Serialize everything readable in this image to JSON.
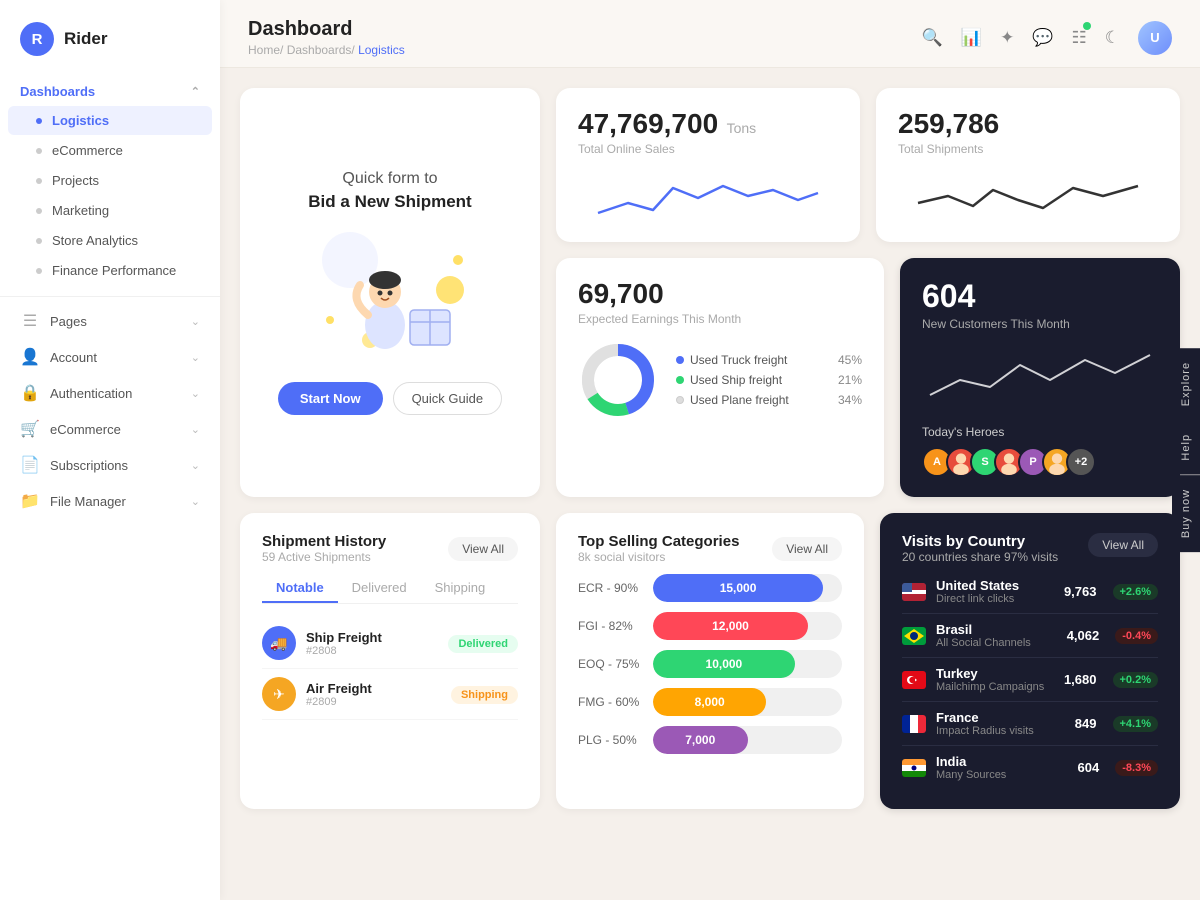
{
  "app": {
    "logo_letter": "R",
    "logo_name": "Rider"
  },
  "sidebar": {
    "dashboards_label": "Dashboards",
    "items": [
      {
        "label": "Logistics",
        "active": true
      },
      {
        "label": "eCommerce",
        "active": false
      },
      {
        "label": "Projects",
        "active": false
      },
      {
        "label": "Marketing",
        "active": false
      },
      {
        "label": "Store Analytics",
        "active": false
      },
      {
        "label": "Finance Performance",
        "active": false
      }
    ],
    "pages_label": "Pages",
    "account_label": "Account",
    "authentication_label": "Authentication",
    "ecommerce_label": "eCommerce",
    "subscriptions_label": "Subscriptions",
    "file_manager_label": "File Manager"
  },
  "header": {
    "title": "Dashboard",
    "breadcrumb": [
      "Home/",
      "Dashboards/",
      "Logistics"
    ]
  },
  "promo": {
    "subtitle": "Quick form to",
    "title": "Bid a New Shipment",
    "start_btn": "Start Now",
    "guide_btn": "Quick Guide"
  },
  "stats": [
    {
      "number": "47,769,700",
      "unit": "Tons",
      "label": "Total Online Sales"
    },
    {
      "number": "259,786",
      "unit": "",
      "label": "Total Shipments"
    }
  ],
  "donut": {
    "number": "69,700",
    "label": "Expected Earnings This Month",
    "segments": [
      {
        "name": "Used Truck freight",
        "pct": "45%",
        "color": "#4f6ef7"
      },
      {
        "name": "Used Ship freight",
        "pct": "21%",
        "color": "#2ed573"
      },
      {
        "name": "Used Plane freight",
        "pct": "34%",
        "color": "#ddd"
      }
    ]
  },
  "hero": {
    "number": "604",
    "label": "New Customers This Month",
    "avatars_label": "Today's Heroes",
    "avatars": [
      {
        "letter": "A",
        "color": "#f7931a"
      },
      {
        "letter": "",
        "color": "#e74c3c"
      },
      {
        "letter": "S",
        "color": "#2ed573"
      },
      {
        "letter": "",
        "color": "#e74c3c"
      },
      {
        "letter": "P",
        "color": "#9b59b6"
      },
      {
        "letter": "",
        "color": "#f5a623"
      },
      {
        "letter": "+2",
        "color": "#555"
      }
    ]
  },
  "shipment": {
    "title": "Shipment History",
    "subtitle": "59 Active Shipments",
    "view_all": "View All",
    "tabs": [
      "Notable",
      "Delivered",
      "Shipping"
    ],
    "items": [
      {
        "name": "Ship Freight",
        "id": "2808",
        "status": "Delivered",
        "status_type": "delivered"
      },
      {
        "name": "Air Freight",
        "id": "2809",
        "status": "Shipping",
        "status_type": "shipping"
      }
    ]
  },
  "selling": {
    "title": "Top Selling Categories",
    "subtitle": "8k social visitors",
    "view_all": "View All",
    "bars": [
      {
        "label": "ECR - 90%",
        "value": 15000,
        "display": "15,000",
        "color": "#4f6ef7",
        "width": "90%"
      },
      {
        "label": "FGI - 82%",
        "value": 12000,
        "display": "12,000",
        "color": "#ff4757",
        "width": "82%"
      },
      {
        "label": "EOQ - 75%",
        "value": 10000,
        "display": "10,000",
        "color": "#2ed573",
        "width": "75%"
      },
      {
        "label": "FMG - 60%",
        "value": 8000,
        "display": "8,000",
        "color": "#ffa502",
        "width": "60%"
      },
      {
        "label": "PLG - 50%",
        "value": 7000,
        "display": "7,000",
        "color": "#9b59b6",
        "width": "50%"
      }
    ]
  },
  "visits": {
    "title": "Visits by Country",
    "subtitle": "20 countries share 97% visits",
    "view_all": "View All",
    "countries": [
      {
        "name": "United States",
        "sub": "Direct link clicks",
        "visits": "9,763",
        "change": "+2.6%",
        "up": true,
        "flag_color": "#3c5a99"
      },
      {
        "name": "Brasil",
        "sub": "All Social Channels",
        "visits": "4,062",
        "change": "-0.4%",
        "up": false,
        "flag_color": "#009c3b"
      },
      {
        "name": "Turkey",
        "sub": "Mailchimp Campaigns",
        "visits": "1,680",
        "change": "+0.2%",
        "up": true,
        "flag_color": "#e30a17"
      },
      {
        "name": "France",
        "sub": "Impact Radius visits",
        "visits": "849",
        "change": "+4.1%",
        "up": true,
        "flag_color": "#002395"
      },
      {
        "name": "India",
        "sub": "Many Sources",
        "visits": "604",
        "change": "-8.3%",
        "up": false,
        "flag_color": "#ff9933"
      }
    ]
  },
  "side_buttons": [
    "Explore",
    "Help",
    "Buy now"
  ],
  "colors": {
    "primary": "#4f6ef7",
    "dark_bg": "#1a1c2e",
    "success": "#2ed573",
    "danger": "#ff4757"
  }
}
